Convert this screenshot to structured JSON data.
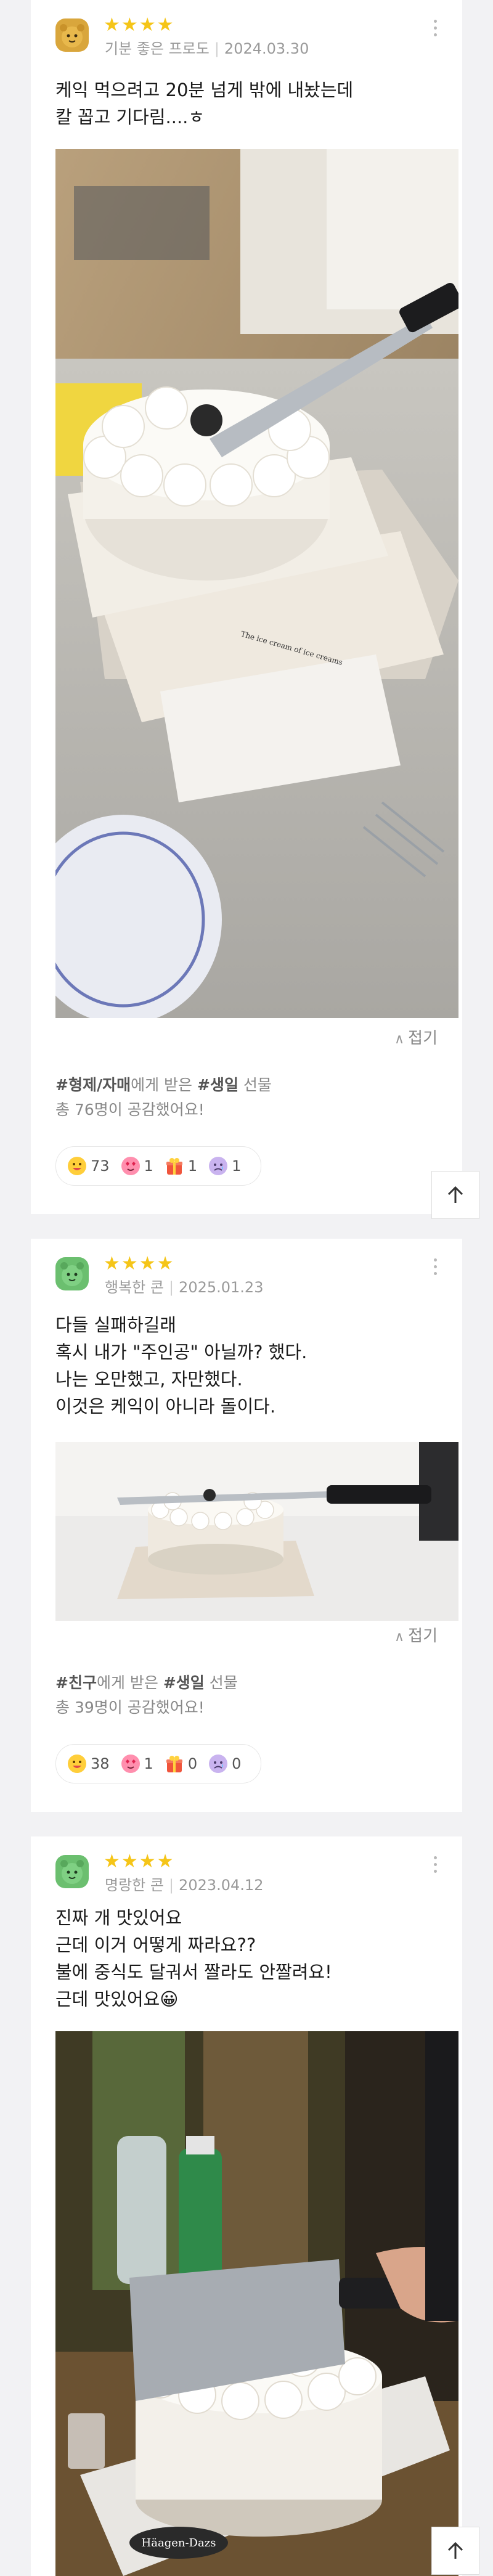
{
  "reviews": [
    {
      "stars": "★★★★",
      "author": "기분 좋은 프로도",
      "date": "2024.03.30",
      "text": [
        "케익 먹으려고 20분 넘게 밖에 내놨는데",
        "칼 꼽고 기다림....ㅎ"
      ],
      "fold_label": "접기",
      "gift": {
        "relation": "#형제/자매",
        "middle": "에게 받은 ",
        "occasion": "#생일",
        "suffix": " 선물"
      },
      "likes_text": "총 76명이 공감했어요!",
      "reactions": [
        {
          "icon": "smile-emoji-icon",
          "count": "73"
        },
        {
          "icon": "heart-eyes-emoji-icon",
          "count": "1"
        },
        {
          "icon": "gift-emoji-icon",
          "count": "1"
        },
        {
          "icon": "sad-emoji-icon",
          "count": "1"
        }
      ]
    },
    {
      "stars": "★★★★",
      "author": "행복한 콘",
      "date": "2025.01.23",
      "text": [
        "다들 실패하길래",
        "혹시 내가 \"주인공\" 아닐까? 했다.",
        "나는 오만했고, 자만했다.",
        "이것은 케익이 아니라 돌이다."
      ],
      "fold_label": "접기",
      "gift": {
        "relation": "#친구",
        "middle": "에게 받은 ",
        "occasion": "#생일",
        "suffix": " 선물"
      },
      "likes_text": "총 39명이 공감했어요!",
      "reactions": [
        {
          "icon": "smile-emoji-icon",
          "count": "38"
        },
        {
          "icon": "heart-eyes-emoji-icon",
          "count": "1"
        },
        {
          "icon": "gift-emoji-icon",
          "count": "0"
        },
        {
          "icon": "sad-emoji-icon",
          "count": "0"
        }
      ]
    },
    {
      "stars": "★★★★",
      "author": "명랑한 콘",
      "date": "2023.04.12",
      "text": [
        "진짜 개 맛있어요",
        "근데 이거 어떻게 짜라요??",
        "불에 중식도 달궈서 짤라도 안짤려요!",
        "근데 맛있어요😀"
      ],
      "photo_brand": "Häagen-Dazs"
    }
  ],
  "photo_caption_1": "The ice cream of ice creams",
  "colors": {
    "star": "#f5c518",
    "page_bg": "#f2f2f4",
    "card_bg": "#ffffff",
    "muted": "#9a9a9a"
  }
}
